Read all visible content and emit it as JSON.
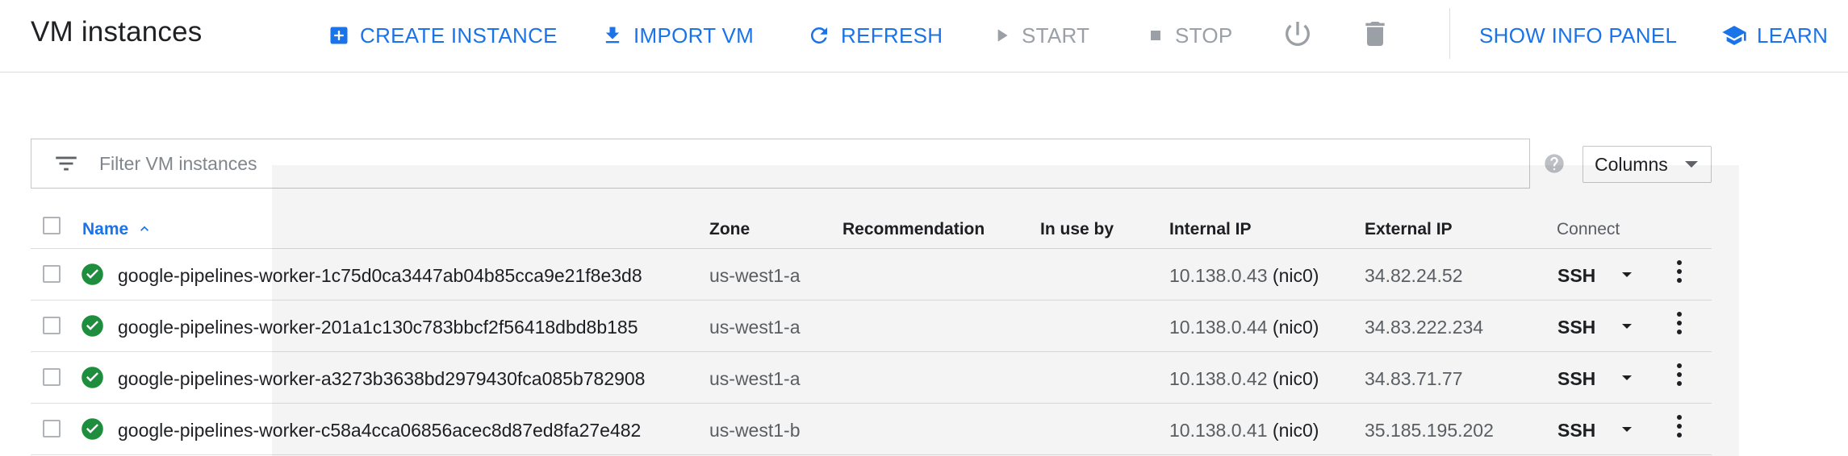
{
  "header": {
    "title": "VM instances",
    "buttons": {
      "create": "CREATE INSTANCE",
      "import": "IMPORT VM",
      "refresh": "REFRESH",
      "start": "START",
      "stop": "STOP",
      "show_info_panel": "SHOW INFO PANEL",
      "learn": "LEARN"
    },
    "icons": {
      "create": "add-box-icon",
      "import": "download-icon",
      "refresh": "refresh-icon",
      "start": "play-icon",
      "stop": "stop-icon",
      "reset": "power-icon",
      "delete": "trash-icon",
      "learn": "school-icon"
    }
  },
  "filter": {
    "placeholder": "Filter VM instances",
    "columns_label": "Columns"
  },
  "table": {
    "columns": {
      "name": "Name",
      "zone": "Zone",
      "recommendation": "Recommendation",
      "in_use_by": "In use by",
      "internal_ip": "Internal IP",
      "external_ip": "External IP",
      "connect": "Connect"
    },
    "sort": {
      "column": "Name",
      "direction": "ascending"
    },
    "rows": [
      {
        "name": "google-pipelines-worker-1c75d0ca3447ab04b85cca9e21f8e3d8",
        "zone": "us-west1-a",
        "recommendation": "",
        "in_use_by": "",
        "internal_ip": "10.138.0.43",
        "nic": "(nic0)",
        "external_ip": "34.82.24.52",
        "connect": "SSH",
        "status": "running"
      },
      {
        "name": "google-pipelines-worker-201a1c130c783bbcf2f56418dbd8b185",
        "zone": "us-west1-a",
        "recommendation": "",
        "in_use_by": "",
        "internal_ip": "10.138.0.44",
        "nic": "(nic0)",
        "external_ip": "34.83.222.234",
        "connect": "SSH",
        "status": "running"
      },
      {
        "name": "google-pipelines-worker-a3273b3638bd2979430fca085b782908",
        "zone": "us-west1-a",
        "recommendation": "",
        "in_use_by": "",
        "internal_ip": "10.138.0.42",
        "nic": "(nic0)",
        "external_ip": "34.83.71.77",
        "connect": "SSH",
        "status": "running"
      },
      {
        "name": "google-pipelines-worker-c58a4cca06856acec8d87ed8fa27e482",
        "zone": "us-west1-b",
        "recommendation": "",
        "in_use_by": "",
        "internal_ip": "10.138.0.41",
        "nic": "(nic0)",
        "external_ip": "35.185.195.202",
        "connect": "SSH",
        "status": "running"
      }
    ]
  },
  "colors": {
    "accent": "#1a73e8",
    "disabled": "#9aa0a6",
    "status_ok": "#1e8e3e"
  }
}
